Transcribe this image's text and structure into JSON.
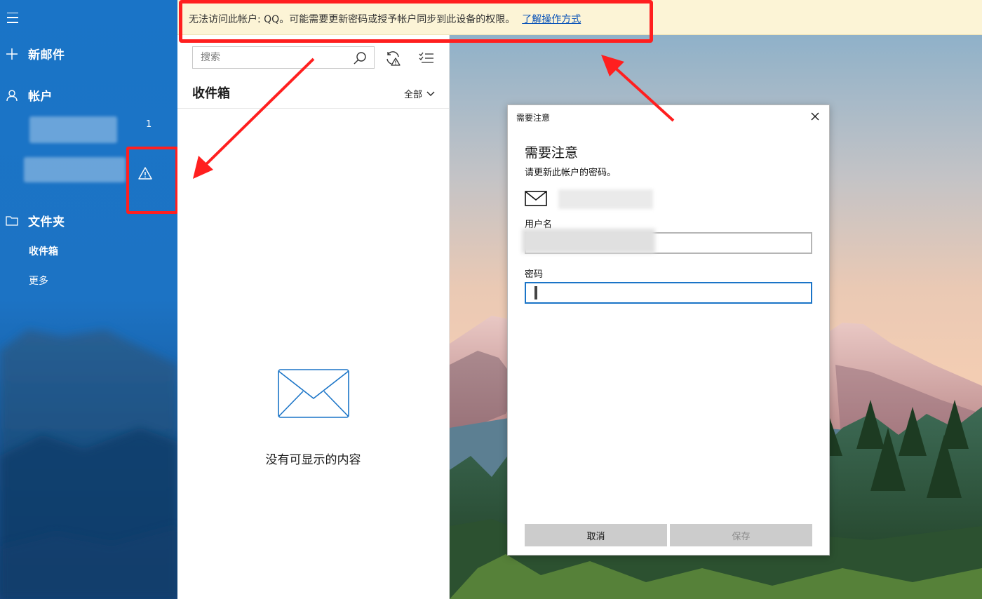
{
  "sidebar": {
    "new_mail_label": "新邮件",
    "accounts_label": "帐户",
    "accounts": [
      {
        "unread_count": "1",
        "status_icon": "none"
      },
      {
        "unread_count": "",
        "status_icon": "warning-icon"
      }
    ],
    "folders_label": "文件夹",
    "folders": [
      {
        "label": "收件箱"
      },
      {
        "label": "更多"
      }
    ]
  },
  "notification": {
    "message": "无法访问此帐户: QQ。可能需要更新密码或授予帐户同步到此设备的权限。",
    "link_label": "了解操作方式"
  },
  "list": {
    "search_placeholder": "搜索",
    "folder_title": "收件箱",
    "filter_label": "全部",
    "empty_message": "没有可显示的内容"
  },
  "dialog": {
    "window_title": "需要注意",
    "heading": "需要注意",
    "description": "请更新此帐户的密码。",
    "username_label": "用户名",
    "username_value": "",
    "password_label": "密码",
    "password_value": "",
    "cancel_label": "取消",
    "save_label": "保存"
  },
  "colors": {
    "sidebar_blue": "#1a74c7",
    "notification_bg": "#fcf4d6",
    "link_blue": "#0b54b8",
    "annotation_red": "#ff1f1f",
    "focus_blue": "#1a74c7"
  }
}
